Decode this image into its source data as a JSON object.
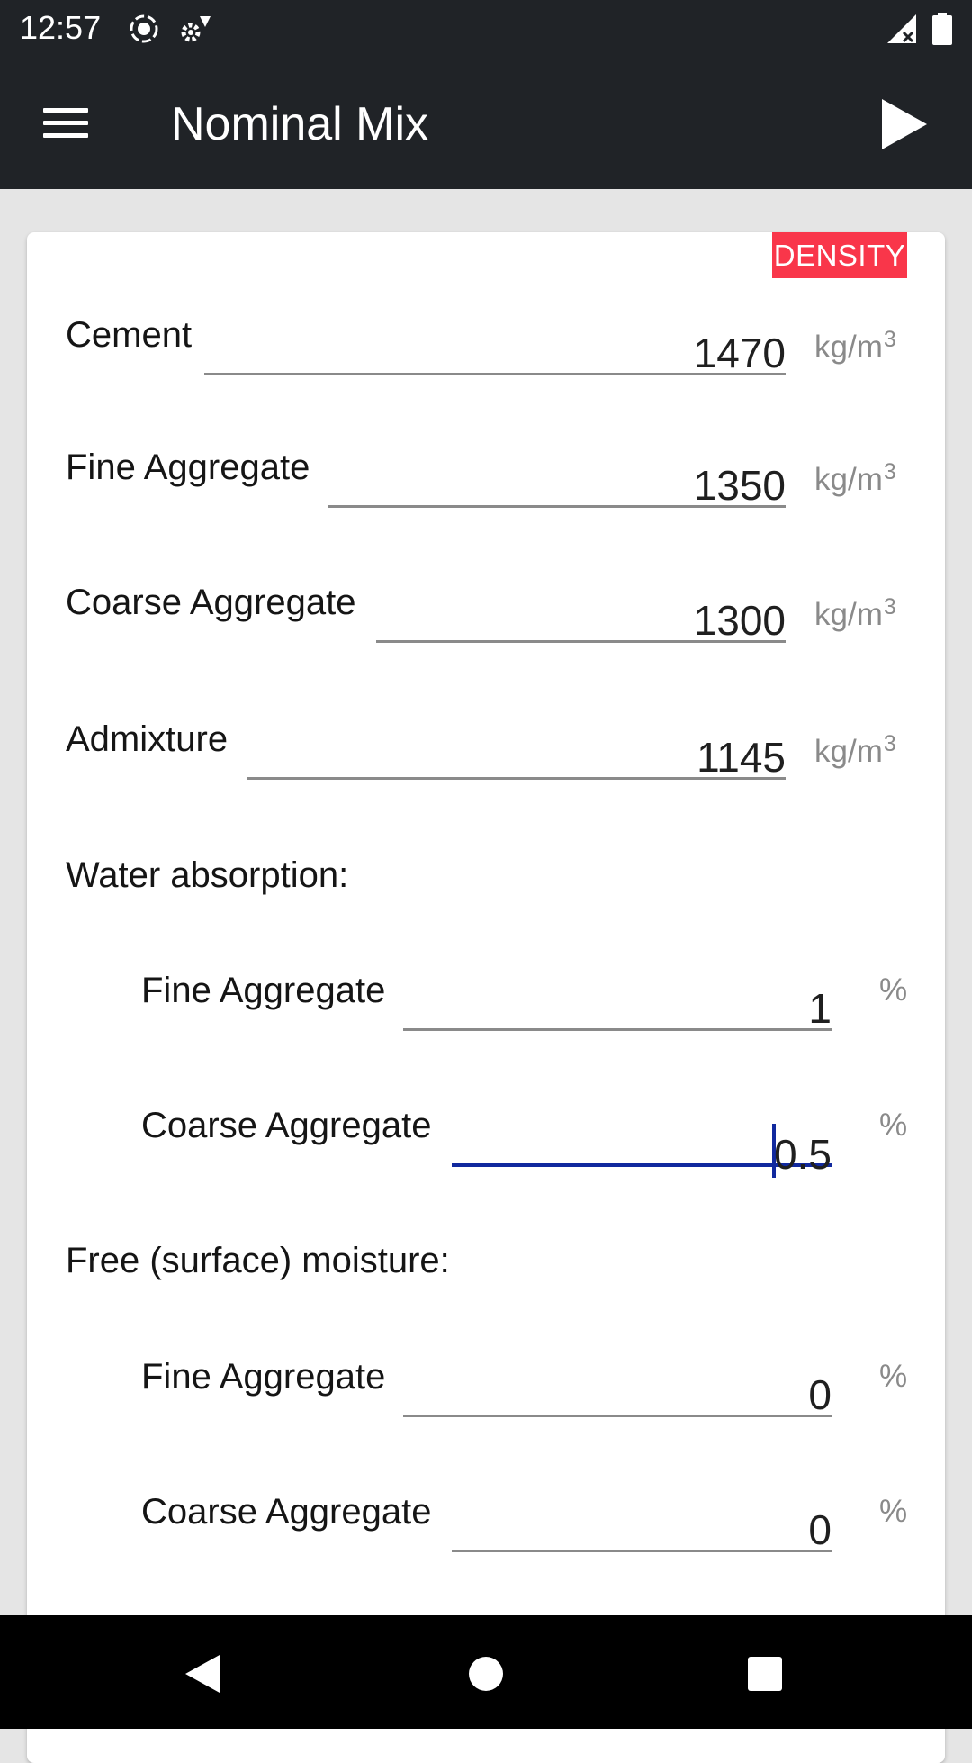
{
  "status_bar": {
    "time": "12:57",
    "icons": [
      "screen-record-icon",
      "settings-cog-icon",
      "signal-icon",
      "battery-icon"
    ]
  },
  "app_bar": {
    "title": "Nominal Mix",
    "menu_icon": "hamburger-menu-icon",
    "action_icon": "play-icon"
  },
  "density_button": {
    "label": "DENSITY",
    "color": "#f9364a"
  },
  "density_fields": [
    {
      "label": "Cement",
      "value": "1470",
      "unit": "kg/m",
      "unit_sup": "3"
    },
    {
      "label": "Fine Aggregate",
      "value": "1350",
      "unit": "kg/m",
      "unit_sup": "3"
    },
    {
      "label": "Coarse Aggregate",
      "value": "1300",
      "unit": "kg/m",
      "unit_sup": "3"
    },
    {
      "label": "Admixture",
      "value": "1145",
      "unit": "kg/m",
      "unit_sup": "3"
    }
  ],
  "water_absorption": {
    "heading": "Water absorption:",
    "fields": [
      {
        "label": "Fine Aggregate",
        "value": "1",
        "unit": "%"
      },
      {
        "label": "Coarse Aggregate",
        "value": "0.5",
        "unit": "%",
        "focused": true
      }
    ]
  },
  "free_moisture": {
    "heading": "Free (surface) moisture:",
    "fields": [
      {
        "label": "Fine Aggregate",
        "value": "0",
        "unit": "%"
      },
      {
        "label": "Coarse Aggregate",
        "value": "0",
        "unit": "%"
      }
    ]
  },
  "nav_bar": {
    "icons": [
      "back-icon",
      "home-icon",
      "recents-icon"
    ]
  },
  "colors": {
    "app_bar": "#202327",
    "accent_focus": "#11299e",
    "background": "#e5e5e5"
  }
}
